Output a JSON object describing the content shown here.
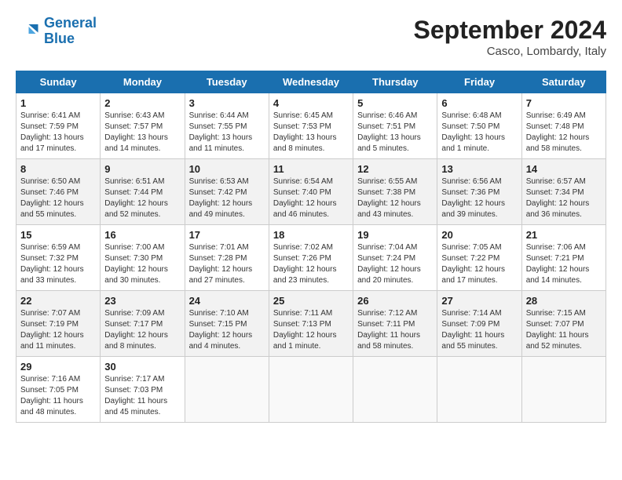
{
  "header": {
    "logo_line1": "General",
    "logo_line2": "Blue",
    "month_title": "September 2024",
    "location": "Casco, Lombardy, Italy"
  },
  "weekdays": [
    "Sunday",
    "Monday",
    "Tuesday",
    "Wednesday",
    "Thursday",
    "Friday",
    "Saturday"
  ],
  "weeks": [
    [
      {
        "day": "1",
        "content": "Sunrise: 6:41 AM\nSunset: 7:59 PM\nDaylight: 13 hours and 17 minutes."
      },
      {
        "day": "2",
        "content": "Sunrise: 6:43 AM\nSunset: 7:57 PM\nDaylight: 13 hours and 14 minutes."
      },
      {
        "day": "3",
        "content": "Sunrise: 6:44 AM\nSunset: 7:55 PM\nDaylight: 13 hours and 11 minutes."
      },
      {
        "day": "4",
        "content": "Sunrise: 6:45 AM\nSunset: 7:53 PM\nDaylight: 13 hours and 8 minutes."
      },
      {
        "day": "5",
        "content": "Sunrise: 6:46 AM\nSunset: 7:51 PM\nDaylight: 13 hours and 5 minutes."
      },
      {
        "day": "6",
        "content": "Sunrise: 6:48 AM\nSunset: 7:50 PM\nDaylight: 13 hours and 1 minute."
      },
      {
        "day": "7",
        "content": "Sunrise: 6:49 AM\nSunset: 7:48 PM\nDaylight: 12 hours and 58 minutes."
      }
    ],
    [
      {
        "day": "8",
        "content": "Sunrise: 6:50 AM\nSunset: 7:46 PM\nDaylight: 12 hours and 55 minutes."
      },
      {
        "day": "9",
        "content": "Sunrise: 6:51 AM\nSunset: 7:44 PM\nDaylight: 12 hours and 52 minutes."
      },
      {
        "day": "10",
        "content": "Sunrise: 6:53 AM\nSunset: 7:42 PM\nDaylight: 12 hours and 49 minutes."
      },
      {
        "day": "11",
        "content": "Sunrise: 6:54 AM\nSunset: 7:40 PM\nDaylight: 12 hours and 46 minutes."
      },
      {
        "day": "12",
        "content": "Sunrise: 6:55 AM\nSunset: 7:38 PM\nDaylight: 12 hours and 43 minutes."
      },
      {
        "day": "13",
        "content": "Sunrise: 6:56 AM\nSunset: 7:36 PM\nDaylight: 12 hours and 39 minutes."
      },
      {
        "day": "14",
        "content": "Sunrise: 6:57 AM\nSunset: 7:34 PM\nDaylight: 12 hours and 36 minutes."
      }
    ],
    [
      {
        "day": "15",
        "content": "Sunrise: 6:59 AM\nSunset: 7:32 PM\nDaylight: 12 hours and 33 minutes."
      },
      {
        "day": "16",
        "content": "Sunrise: 7:00 AM\nSunset: 7:30 PM\nDaylight: 12 hours and 30 minutes."
      },
      {
        "day": "17",
        "content": "Sunrise: 7:01 AM\nSunset: 7:28 PM\nDaylight: 12 hours and 27 minutes."
      },
      {
        "day": "18",
        "content": "Sunrise: 7:02 AM\nSunset: 7:26 PM\nDaylight: 12 hours and 23 minutes."
      },
      {
        "day": "19",
        "content": "Sunrise: 7:04 AM\nSunset: 7:24 PM\nDaylight: 12 hours and 20 minutes."
      },
      {
        "day": "20",
        "content": "Sunrise: 7:05 AM\nSunset: 7:22 PM\nDaylight: 12 hours and 17 minutes."
      },
      {
        "day": "21",
        "content": "Sunrise: 7:06 AM\nSunset: 7:21 PM\nDaylight: 12 hours and 14 minutes."
      }
    ],
    [
      {
        "day": "22",
        "content": "Sunrise: 7:07 AM\nSunset: 7:19 PM\nDaylight: 12 hours and 11 minutes."
      },
      {
        "day": "23",
        "content": "Sunrise: 7:09 AM\nSunset: 7:17 PM\nDaylight: 12 hours and 8 minutes."
      },
      {
        "day": "24",
        "content": "Sunrise: 7:10 AM\nSunset: 7:15 PM\nDaylight: 12 hours and 4 minutes."
      },
      {
        "day": "25",
        "content": "Sunrise: 7:11 AM\nSunset: 7:13 PM\nDaylight: 12 hours and 1 minute."
      },
      {
        "day": "26",
        "content": "Sunrise: 7:12 AM\nSunset: 7:11 PM\nDaylight: 11 hours and 58 minutes."
      },
      {
        "day": "27",
        "content": "Sunrise: 7:14 AM\nSunset: 7:09 PM\nDaylight: 11 hours and 55 minutes."
      },
      {
        "day": "28",
        "content": "Sunrise: 7:15 AM\nSunset: 7:07 PM\nDaylight: 11 hours and 52 minutes."
      }
    ],
    [
      {
        "day": "29",
        "content": "Sunrise: 7:16 AM\nSunset: 7:05 PM\nDaylight: 11 hours and 48 minutes."
      },
      {
        "day": "30",
        "content": "Sunrise: 7:17 AM\nSunset: 7:03 PM\nDaylight: 11 hours and 45 minutes."
      },
      {
        "day": "",
        "content": ""
      },
      {
        "day": "",
        "content": ""
      },
      {
        "day": "",
        "content": ""
      },
      {
        "day": "",
        "content": ""
      },
      {
        "day": "",
        "content": ""
      }
    ]
  ]
}
